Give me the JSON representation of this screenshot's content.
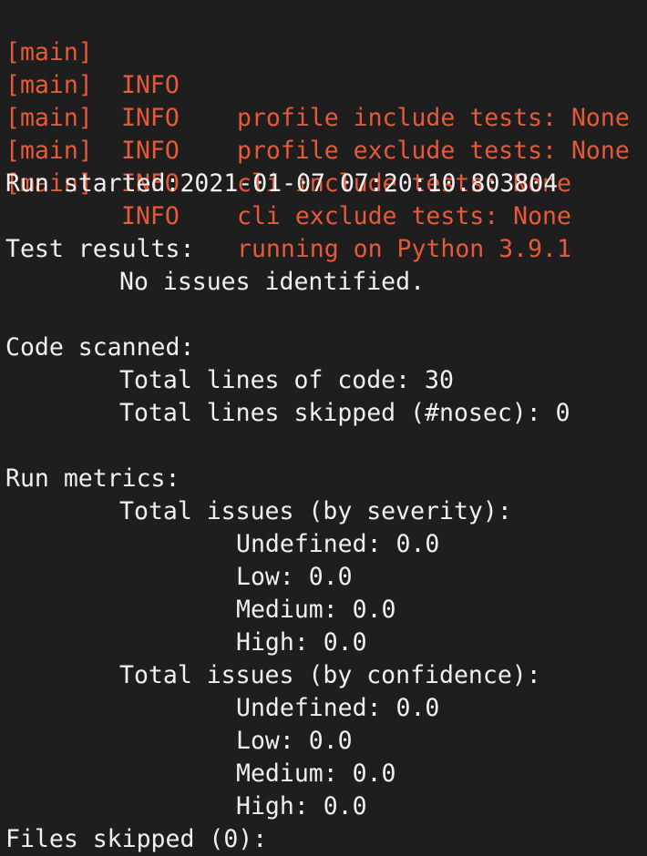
{
  "colors": {
    "background": "#1e1e1e",
    "log_text": "#e8593a",
    "text": "#f0f0f0"
  },
  "log_lines": [
    {
      "tag": "[main]",
      "level": "INFO",
      "message": "profile include tests: None"
    },
    {
      "tag": "[main]",
      "level": "INFO",
      "message": "profile exclude tests: None"
    },
    {
      "tag": "[main]",
      "level": "INFO",
      "message": "cli include tests: None"
    },
    {
      "tag": "[main]",
      "level": "INFO",
      "message": "cli exclude tests: None"
    },
    {
      "tag": "[main]",
      "level": "INFO",
      "message": "running on Python 3.9.1"
    }
  ],
  "report": {
    "run_started": "Run started:2021-01-07 07:20:10.803804",
    "test_results_heading": "Test results:",
    "test_results_value": "No issues identified.",
    "code_scanned_heading": "Code scanned:",
    "total_lines_of_code": "Total lines of code: 30",
    "total_lines_skipped": "Total lines skipped (#nosec): 0",
    "run_metrics_heading": "Run metrics:",
    "by_severity_heading": "Total issues (by severity):",
    "severity": {
      "undefined": "Undefined: 0.0",
      "low": "Low: 0.0",
      "medium": "Medium: 0.0",
      "high": "High: 0.0"
    },
    "by_confidence_heading": "Total issues (by confidence):",
    "confidence": {
      "undefined": "Undefined: 0.0",
      "low": "Low: 0.0",
      "medium": "Medium: 0.0",
      "high": "High: 0.0"
    },
    "files_skipped": "Files skipped (0):"
  }
}
